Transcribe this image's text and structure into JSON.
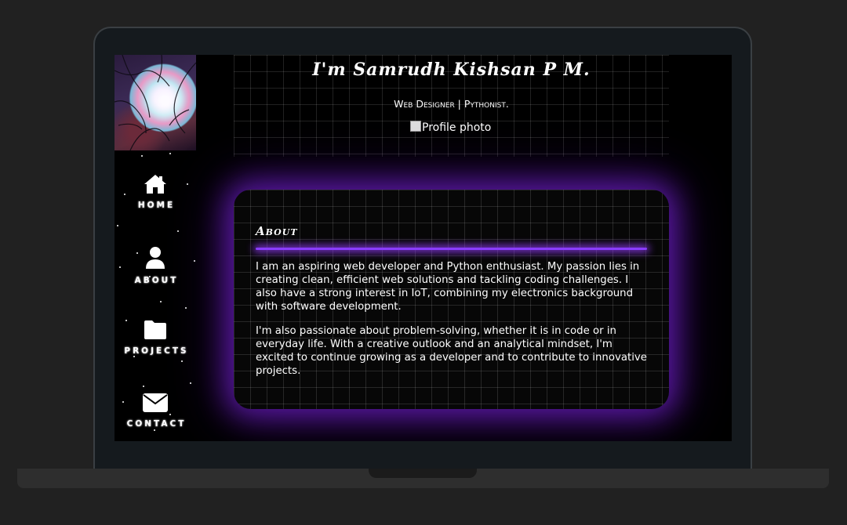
{
  "header": {
    "name": "I'm Samrudh Kishsan P M.",
    "role": "Web Designer | Pythonist.",
    "photo_alt": "Profile photo"
  },
  "nav": {
    "items": [
      {
        "label": "HOME",
        "icon": "home-icon"
      },
      {
        "label": "ABOUT",
        "icon": "user-icon"
      },
      {
        "label": "PROJECTS",
        "icon": "folder-icon"
      },
      {
        "label": "CONTACT",
        "icon": "envelope-icon"
      }
    ]
  },
  "about": {
    "title": "About",
    "paragraphs": [
      "I am an aspiring web developer and Python enthusiast. My passion lies in creating clean, efficient web solutions and tackling coding challenges. I also have a strong interest in IoT, combining my electronics background with software development.",
      "I'm also passionate about problem-solving, whether it is in code or in everyday life. With a creative outlook and an analytical mindset, I'm excited to continue growing as a developer and to contribute to innovative projects."
    ]
  },
  "colors": {
    "accent": "#8a3cff",
    "background": "#000000",
    "frame": "#151a1e",
    "desk": "#212121"
  }
}
